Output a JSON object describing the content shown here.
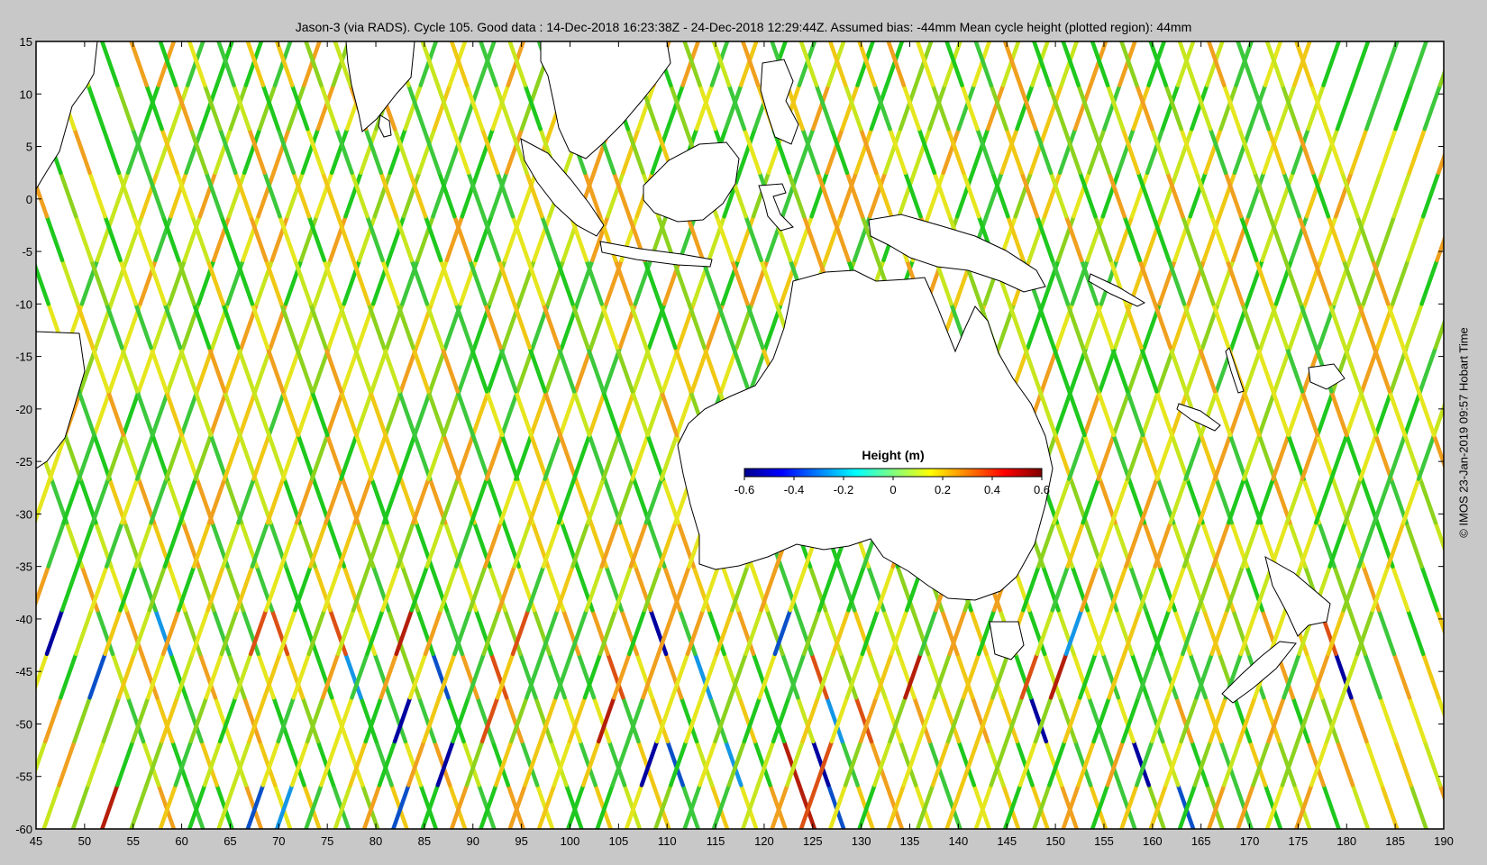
{
  "title": "Jason-3 (via RADS). Cycle 105. Good data : 14-Dec-2018 16:23:38Z - 24-Dec-2018 12:29:44Z. Assumed bias: -44mm  Mean cycle height (plotted region): 44mm",
  "credit": "©  IMOS 23-Jan-2019 09:57 Hobart Time",
  "map": {
    "lon_range": [
      45,
      190
    ],
    "lat_range": [
      -60,
      15
    ],
    "x_ticks": [
      45,
      50,
      55,
      60,
      65,
      70,
      75,
      80,
      85,
      90,
      95,
      100,
      105,
      110,
      115,
      120,
      125,
      130,
      135,
      140,
      145,
      150,
      155,
      160,
      165,
      170,
      175,
      180,
      185,
      190
    ],
    "y_ticks": [
      15,
      10,
      5,
      0,
      -5,
      -10,
      -15,
      -20,
      -25,
      -30,
      -35,
      -40,
      -45,
      -50,
      -55,
      -60
    ],
    "background": "#ffffff",
    "frame_color": "#000000",
    "coastline_color": "#000000",
    "landmasses": [
      "Africa",
      "Arabia",
      "India",
      "Sri Lanka",
      "Madagascar",
      "Southeast Asia",
      "Sumatra",
      "Borneo",
      "Java",
      "Sulawesi",
      "New Guinea",
      "Australia",
      "Tasmania",
      "New Zealand",
      "New Caledonia",
      "Solomon Islands",
      "Vanuatu",
      "Fiji",
      "Philippines"
    ]
  },
  "colorbar": {
    "label": "Height (m)",
    "ticks": [
      "-0.6",
      "-0.4",
      "-0.2",
      "0",
      "0.2",
      "0.4",
      "0.6"
    ],
    "range": [
      -0.6,
      0.6
    ],
    "colormap": [
      "#00008f",
      "#0000ff",
      "#0080ff",
      "#00ffff",
      "#80ff80",
      "#ffff00",
      "#ff8000",
      "#ff0000",
      "#800000"
    ]
  },
  "tracks": {
    "ascending_start_lons": [
      45,
      48,
      51,
      54,
      57,
      60,
      63,
      66,
      69,
      72,
      75,
      78,
      81,
      84,
      87,
      90,
      93,
      96,
      99,
      102,
      105,
      108,
      111,
      114,
      117,
      120,
      123,
      126,
      129,
      132,
      135,
      138,
      141,
      144,
      147,
      150,
      153,
      156,
      159,
      162,
      165,
      168,
      171,
      174,
      177,
      180,
      183,
      186,
      189
    ],
    "dominant_colors": [
      "#1ec81e",
      "#3cc83c",
      "#8cd21e",
      "#c8e61e",
      "#e6e61e",
      "#f0c814",
      "#f0a01e"
    ],
    "anomaly_colors": [
      "#0a50c8",
      "#1496e6",
      "#dc5014",
      "#b41e0a",
      "#0000a0"
    ]
  }
}
